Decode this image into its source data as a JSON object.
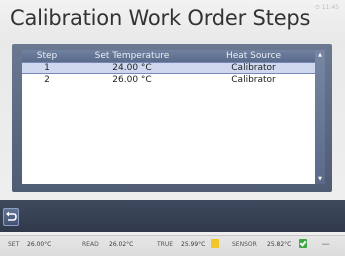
{
  "header": {
    "title": "Calibration Work Order Steps",
    "clock": "⏲ 11:45"
  },
  "table": {
    "columns": {
      "step": "Step",
      "set_temperature": "Set Temperature",
      "heat_source": "Heat Source"
    },
    "rows": [
      {
        "step": "1",
        "set_temperature": "24.00 °C",
        "heat_source": "Calibrator",
        "selected": true
      },
      {
        "step": "2",
        "set_temperature": "26.00 °C",
        "heat_source": "Calibrator",
        "selected": false
      }
    ]
  },
  "status_bar": {
    "set_label": "SET",
    "set_value": "26.00°C",
    "read_label": "READ",
    "read_value": "26.02°C",
    "true_label": "TRUE",
    "true_value": "25.99°C",
    "sensor_label": "SENSOR",
    "sensor_value": "25.82°C"
  },
  "colors": {
    "header_blue": "#5a6a8a",
    "selected_row": "#cfd8ee",
    "true_indicator": "#f0c62a",
    "sensor_indicator": "#3fa744"
  },
  "icons": {
    "back": "back-arrow-icon",
    "true_indicator": "warning-square-icon",
    "sensor_indicator": "check-square-icon",
    "extra": "probe-icon"
  }
}
